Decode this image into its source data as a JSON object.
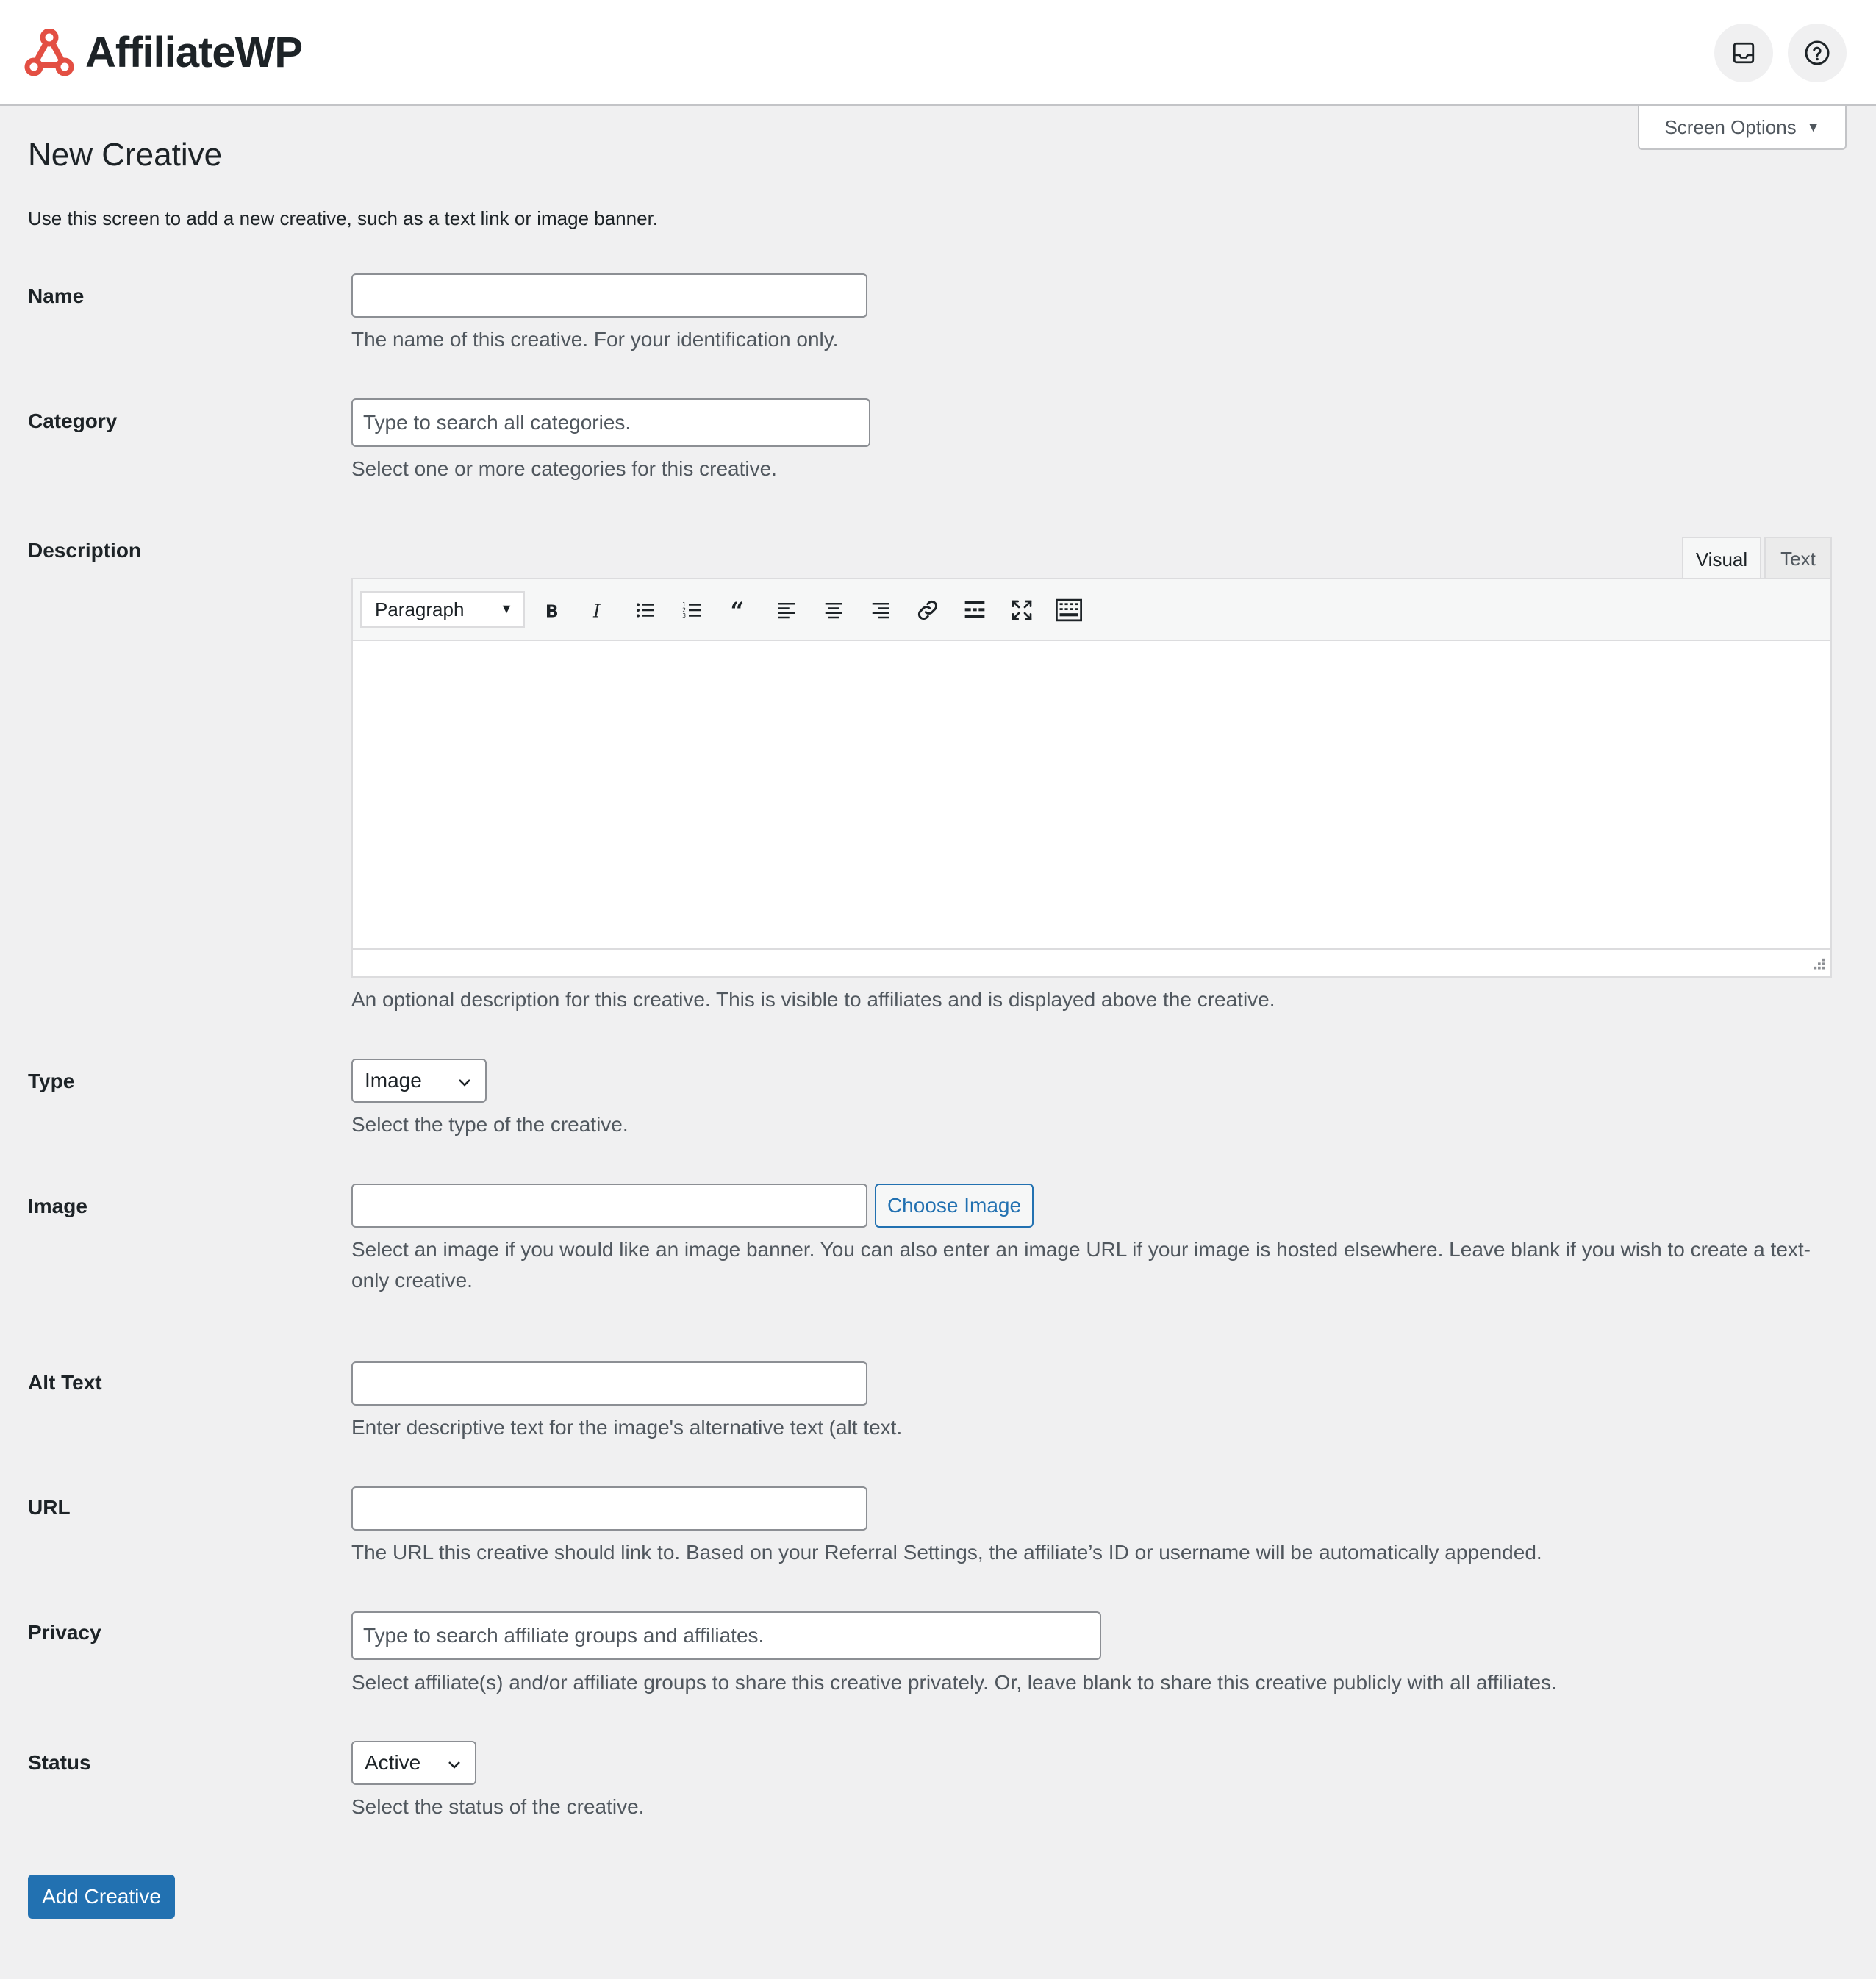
{
  "app": {
    "name": "AffiliateWP"
  },
  "header": {
    "inbox_icon": "inbox-icon",
    "help_icon": "help-icon",
    "brand_color": "#e34f43"
  },
  "screen_options": {
    "label": "Screen Options"
  },
  "page": {
    "title": "New Creative",
    "intro": "Use this screen to add a new creative, such as a text link or image banner."
  },
  "form": {
    "name": {
      "label": "Name",
      "value": "",
      "help": "The name of this creative. For your identification only."
    },
    "category": {
      "label": "Category",
      "placeholder": "Type to search all categories.",
      "help": "Select one or more categories for this creative."
    },
    "description": {
      "label": "Description",
      "tabs": [
        "Visual",
        "Text"
      ],
      "active_tab": "Visual",
      "format": "Paragraph",
      "toolbar_icons": [
        "bold-icon",
        "italic-icon",
        "bullet-list-icon",
        "numbered-list-icon",
        "blockquote-icon",
        "align-left-icon",
        "align-center-icon",
        "align-right-icon",
        "link-icon",
        "read-more-icon",
        "fullscreen-icon",
        "toolbar-toggle-icon"
      ],
      "help": "An optional description for this creative. This is visible to affiliates and is displayed above the creative."
    },
    "type": {
      "label": "Type",
      "value": "Image",
      "help": "Select the type of the creative."
    },
    "image": {
      "label": "Image",
      "value": "",
      "button": "Choose Image",
      "help": "Select an image if you would like an image banner. You can also enter an image URL if your image is hosted elsewhere. Leave blank if you wish to create a text-only creative."
    },
    "alt_text": {
      "label": "Alt Text",
      "value": "",
      "help": "Enter descriptive text for the image's alternative text (alt text."
    },
    "url": {
      "label": "URL",
      "value": "",
      "help": "The URL this creative should link to. Based on your Referral Settings, the affiliate’s ID or username will be automatically appended."
    },
    "privacy": {
      "label": "Privacy",
      "placeholder": "Type to search affiliate groups and affiliates.",
      "help": "Select affiliate(s) and/or affiliate groups to share this creative privately. Or, leave blank to share this creative publicly with all affiliates."
    },
    "status": {
      "label": "Status",
      "value": "Active",
      "help": "Select the status of the creative."
    },
    "submit": "Add Creative"
  },
  "colors": {
    "primary": "#2271b1",
    "background": "#f0f0f1"
  }
}
